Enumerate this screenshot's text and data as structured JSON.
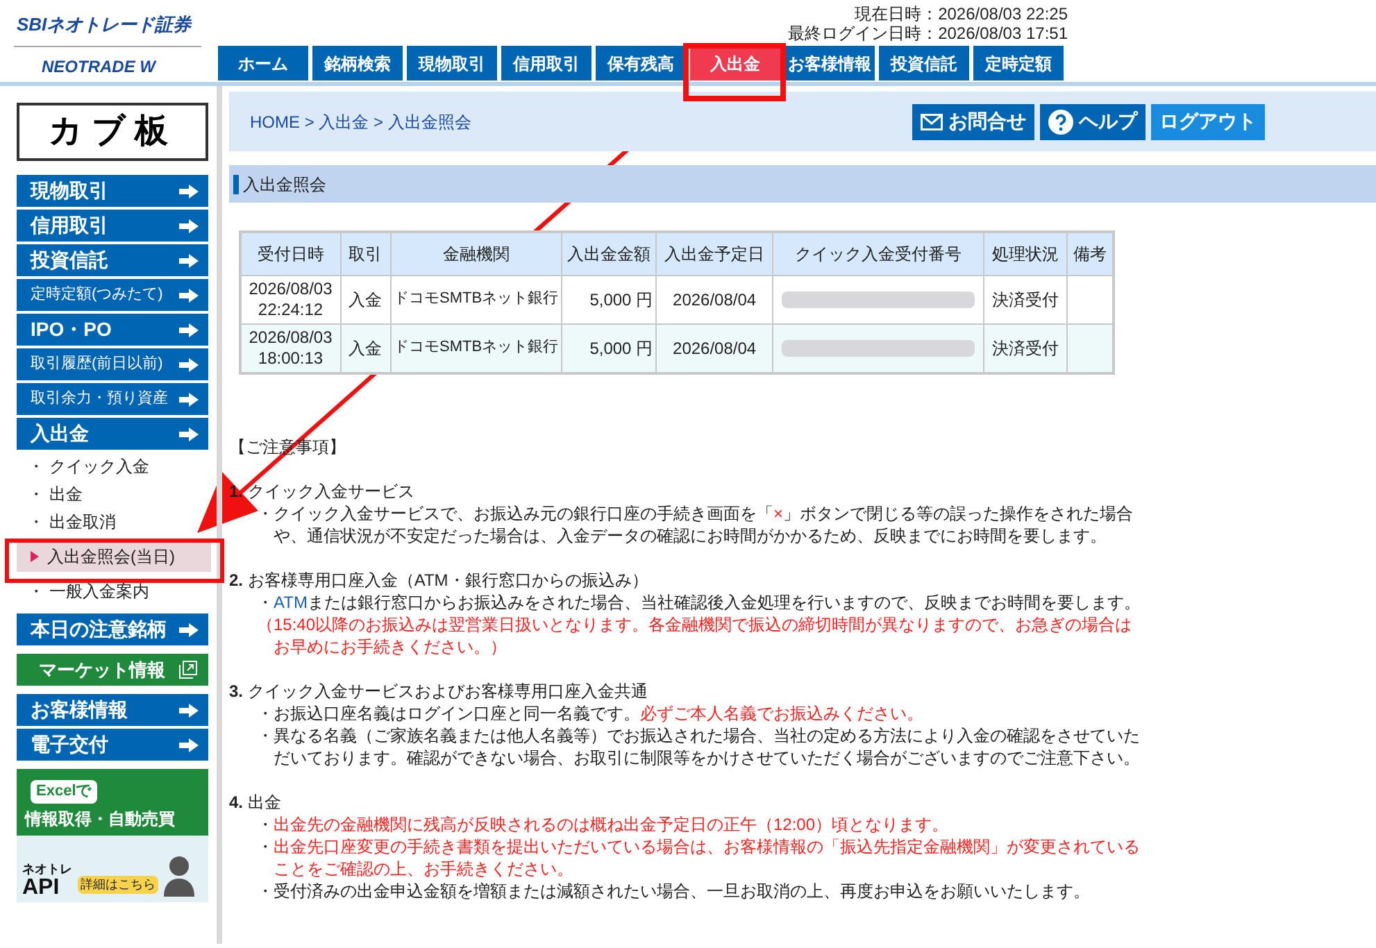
{
  "header": {
    "logo": "SBIネオトレード証券",
    "sublogo": "NEOTRADE W",
    "now": "現在日時：2026/08/03 22:25",
    "last_login": "最終ログイン日時：2026/08/03 17:51"
  },
  "nav_tabs": [
    {
      "label": "ホーム",
      "selected": false
    },
    {
      "label": "銘柄検索",
      "selected": false
    },
    {
      "label": "現物取引",
      "selected": false
    },
    {
      "label": "信用取引",
      "selected": false
    },
    {
      "label": "保有残高",
      "selected": false
    },
    {
      "label": "入出金",
      "selected": true
    },
    {
      "label": "お客様情報",
      "selected": false
    },
    {
      "label": "投資信託",
      "selected": false
    },
    {
      "label": "定時定額",
      "selected": false
    }
  ],
  "sidebar": {
    "banner": "カブ板",
    "groups": [
      {
        "items": [
          {
            "kind": "menu",
            "label": "現物取引"
          },
          {
            "kind": "menu",
            "label": "信用取引"
          },
          {
            "kind": "menu",
            "label": "投資信託"
          },
          {
            "kind": "menu_small",
            "label": "定時定額(つみたて)"
          },
          {
            "kind": "menu",
            "label": "IPO・PO"
          },
          {
            "kind": "menu_small",
            "label": "取引履歴(前日以前)"
          },
          {
            "kind": "menu_small",
            "label": "取引余力・預り資産"
          },
          {
            "kind": "menu",
            "label": "入出金"
          },
          {
            "kind": "sub",
            "label": "・ クイック入金",
            "selected": false
          },
          {
            "kind": "sub",
            "label": "・ 出金",
            "selected": false
          },
          {
            "kind": "sub",
            "label": "・ 出金取消",
            "selected": false
          },
          {
            "kind": "sub",
            "label": "入出金照会(当日)",
            "selected": true
          },
          {
            "kind": "sub",
            "label": "・ 一般入金案内",
            "selected": false
          }
        ]
      },
      {
        "items": [
          {
            "kind": "menu",
            "label": "本日の注意銘柄"
          }
        ]
      },
      {
        "items": [
          {
            "kind": "external",
            "label": "マーケット情報"
          }
        ]
      },
      {
        "items": [
          {
            "kind": "menu",
            "label": "お客様情報"
          },
          {
            "kind": "menu",
            "label": "電子交付"
          }
        ]
      }
    ],
    "ad": {
      "tag": "Excelで",
      "headline": "情報取得・自動売買",
      "brand": "ネオトレ",
      "product": "API",
      "cta": "詳細はこちら"
    }
  },
  "breadcrumb": "HOME > 入出金 > 入出金照会",
  "header_buttons": [
    {
      "kind": "mail",
      "label": "お問合せ"
    },
    {
      "kind": "help",
      "label": "ヘルプ"
    },
    {
      "kind": "plain",
      "label": "ログアウト"
    }
  ],
  "page_title": "入出金照会",
  "table": {
    "columns": [
      "受付日時",
      "取引",
      "金融機関",
      "入出金金額",
      "入出金予定日",
      "クイック入金受付番号",
      "処理状況",
      "備考"
    ],
    "rows": [
      {
        "date": "2026/08/03",
        "time": "22:24:12",
        "type": "入金",
        "bank": "ドコモSMTBネット銀行",
        "amount": "5,000 円",
        "scheduled": "2026/08/04",
        "status": "決済受付"
      },
      {
        "date": "2026/08/03",
        "time": "18:00:13",
        "type": "入金",
        "bank": "ドコモSMTBネット銀行",
        "amount": "5,000 円",
        "scheduled": "2026/08/04",
        "status": "決済受付"
      }
    ]
  },
  "notes": {
    "title": "【ご注意事項】",
    "sections": [
      {
        "number": "1.",
        "heading": "クイック入金サービス",
        "paragraphs": [
          [
            {
              "text": "・クイック入金サービスで、お振込み元の銀行口座の手続き画面を「",
              "kind": "normal"
            },
            {
              "text": "×",
              "kind": "alert"
            },
            {
              "text": "」ボタンで閉じる等の誤った操作をされた場合や、通信状況が不安定だった場合は、入金データの確認にお時間がかかるため、反映までにお時間を要します。",
              "kind": "normal"
            }
          ]
        ]
      },
      {
        "number": "2.",
        "heading": "お客様専用口座入金（ATM・銀行窓口からの振込み）",
        "paragraphs": [
          [
            {
              "text": "・",
              "kind": "normal"
            },
            {
              "text": "ATM",
              "kind": "link"
            },
            {
              "text": "または銀行窓口からお振込みをされた場合、当社確認後入金処理を行いますので、反映までお時間を要します。",
              "kind": "normal"
            }
          ],
          [
            {
              "text": "（15:40以降のお振込みは翌営業日扱いとなります。各金融機関で振込の締切時間が異なりますので、お急ぎの場合はお早めにお手続きください。）",
              "kind": "alert"
            }
          ]
        ]
      },
      {
        "number": "3.",
        "heading": "クイック入金サービスおよびお客様専用口座入金共通",
        "paragraphs": [
          [
            {
              "text": "・お振込口座名義はログイン口座と同一名義です。",
              "kind": "normal"
            },
            {
              "text": "必ずご本人名義でお振込みください。",
              "kind": "alert"
            }
          ],
          [
            {
              "text": "・異なる名義（ご家族名義または他人名義等）でお振込された場合、当社の定める方法により入金の確認をさせていただいております。確認ができない場合、お取引に制限等をかけさせていただく場合がございますのでご注意下さい。",
              "kind": "normal"
            }
          ]
        ]
      },
      {
        "number": "4.",
        "heading": "出金",
        "paragraphs": [
          [
            {
              "text": "・",
              "kind": "normal"
            },
            {
              "text": "出金先の金融機関に残高が反映されるのは概ね出金予定日の正午（12:00）頃となります。",
              "kind": "alert"
            }
          ],
          [
            {
              "text": "・",
              "kind": "normal"
            },
            {
              "text": "出金先口座変更の手続き書類を提出いただいている場合は、お客様情報の「振込先指定金融機関」が変更されていることをご確認の上、お手続きください。",
              "kind": "alert"
            }
          ],
          [
            {
              "text": "・受付済みの出金申込金額を増額または減額されたい場合、一旦お取消の上、再度お申込をお願いいたします。",
              "kind": "normal"
            }
          ]
        ]
      }
    ]
  }
}
